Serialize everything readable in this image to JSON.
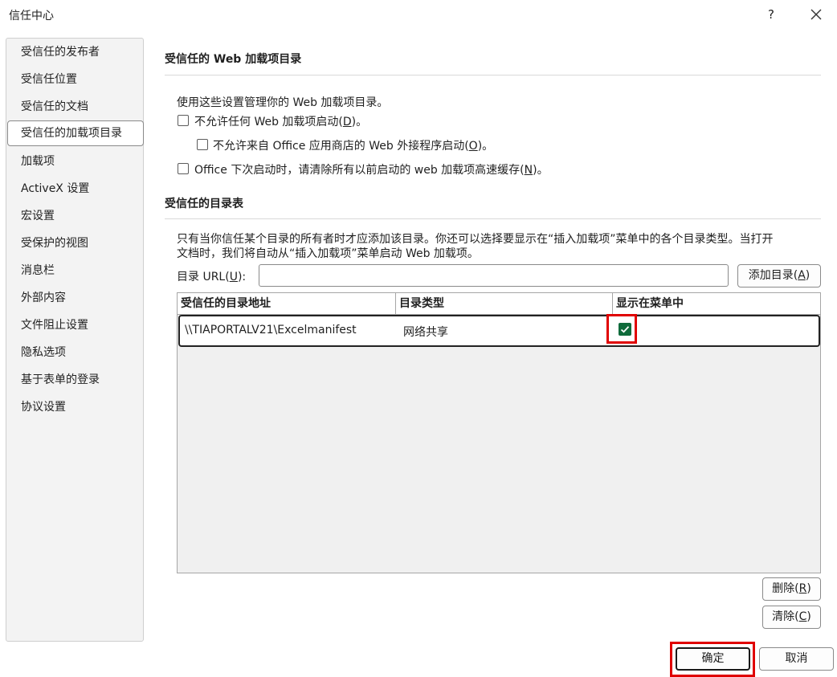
{
  "window": {
    "title": "信任中心",
    "help_label": "?"
  },
  "sidebar": {
    "items": [
      {
        "label": "受信任的发布者"
      },
      {
        "label": "受信任位置"
      },
      {
        "label": "受信任的文档"
      },
      {
        "label": "受信任的加载项目录",
        "selected": true
      },
      {
        "label": "加载项"
      },
      {
        "label": "ActiveX 设置"
      },
      {
        "label": "宏设置"
      },
      {
        "label": "受保护的视图"
      },
      {
        "label": "消息栏"
      },
      {
        "label": "外部内容"
      },
      {
        "label": "文件阻止设置"
      },
      {
        "label": "隐私选项"
      },
      {
        "label": "基于表单的登录"
      },
      {
        "label": "协议设置"
      }
    ]
  },
  "web_catalog": {
    "heading": "受信任的 Web 加载项目录",
    "description": "使用这些设置管理你的 Web 加载项目录。",
    "opt_disable_all": {
      "pre": "不允许任何 Web 加载项启动(",
      "key": "D",
      "post": ")。",
      "checked": false
    },
    "opt_disable_store": {
      "pre": "不允许来自 Office 应用商店的 Web 外接程序启动(",
      "key": "O",
      "post": ")。",
      "checked": false
    },
    "opt_clear_cache": {
      "pre": "Office 下次启动时，请清除所有以前启动的 web 加载项高速缓存(",
      "key": "N",
      "post": ")。",
      "checked": false
    }
  },
  "catalog_table_section": {
    "heading": "受信任的目录表",
    "description_line1": "只有当你信任某个目录的所有者时才应添加该目录。你还可以选择要显示在“插入加载项”菜单中的各个目录类型。当打开",
    "description_line2": "文档时，我们将自动从“插入加载项”菜单启动 Web 加载项。",
    "url_label_pre": "目录 URL(",
    "url_label_key": "U",
    "url_label_post": "):",
    "url_value": "",
    "add_button": {
      "pre": "添加目录(",
      "key": "A",
      "post": ")"
    },
    "columns": [
      "受信任的目录地址",
      "目录类型",
      "显示在菜单中"
    ],
    "rows": [
      {
        "address": "\\\\TIAPORTALV21\\Excelmanifest",
        "type": "网络共享",
        "show_in_menu": true
      }
    ],
    "remove_button": {
      "pre": "删除(",
      "key": "R",
      "post": ")"
    },
    "clear_button": {
      "pre": "清除(",
      "key": "C",
      "post": ")"
    }
  },
  "footer": {
    "ok_label": "确定",
    "cancel_label": "取消"
  },
  "colors": {
    "highlight": "#e00000",
    "checkbox_checked": "#0f6b3b"
  }
}
